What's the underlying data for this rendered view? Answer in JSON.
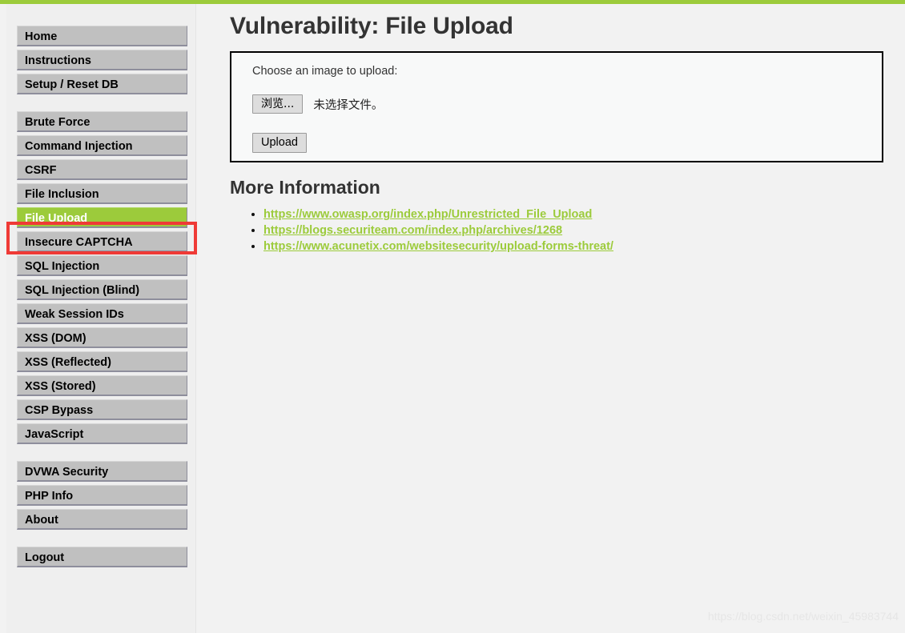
{
  "theme": {
    "accent_green": "#9ccb3b",
    "annotation_red": "#ef3a36",
    "nav_gray": "#c0c0c0",
    "page_background": "#f2f2f2",
    "title_color": "#333333"
  },
  "sidebar": {
    "groups": [
      {
        "items": [
          {
            "label": "Home",
            "active": false
          },
          {
            "label": "Instructions",
            "active": false
          },
          {
            "label": "Setup / Reset DB",
            "active": false
          }
        ]
      },
      {
        "items": [
          {
            "label": "Brute Force",
            "active": false
          },
          {
            "label": "Command Injection",
            "active": false
          },
          {
            "label": "CSRF",
            "active": false
          },
          {
            "label": "File Inclusion",
            "active": false
          },
          {
            "label": "File Upload",
            "active": true
          },
          {
            "label": "Insecure CAPTCHA",
            "active": false
          },
          {
            "label": "SQL Injection",
            "active": false
          },
          {
            "label": "SQL Injection (Blind)",
            "active": false
          },
          {
            "label": "Weak Session IDs",
            "active": false
          },
          {
            "label": "XSS (DOM)",
            "active": false
          },
          {
            "label": "XSS (Reflected)",
            "active": false
          },
          {
            "label": "XSS (Stored)",
            "active": false
          },
          {
            "label": "CSP Bypass",
            "active": false
          },
          {
            "label": "JavaScript",
            "active": false
          }
        ]
      },
      {
        "items": [
          {
            "label": "DVWA Security",
            "active": false
          },
          {
            "label": "PHP Info",
            "active": false
          },
          {
            "label": "About",
            "active": false
          }
        ]
      },
      {
        "items": [
          {
            "label": "Logout",
            "active": false
          }
        ]
      }
    ]
  },
  "main": {
    "page_title": "Vulnerability: File Upload",
    "upload_form": {
      "instruction": "Choose an image to upload:",
      "browse_button_label": "浏览...",
      "file_status_text": "未选择文件。",
      "upload_button_label": "Upload"
    },
    "more_information": {
      "heading": "More Information",
      "links": [
        "https://www.owasp.org/index.php/Unrestricted_File_Upload",
        "https://blogs.securiteam.com/index.php/archives/1268",
        "https://www.acunetix.com/websitesecurity/upload-forms-threat/"
      ]
    }
  },
  "watermark": {
    "text": "https://blog.csdn.net/weixin_45983744"
  }
}
